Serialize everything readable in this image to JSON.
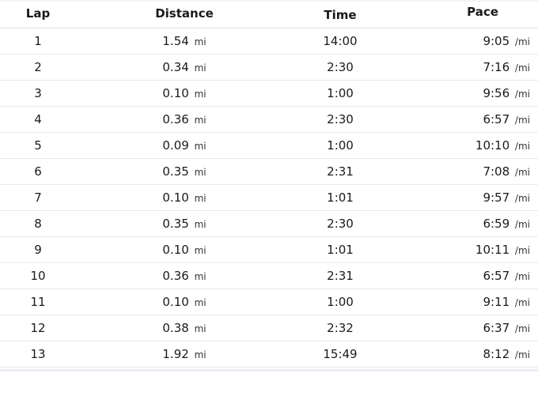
{
  "headers": {
    "lap": "Lap",
    "distance": "Distance",
    "time": "Time",
    "pace": "Pace"
  },
  "rows": [
    {
      "lap": "1",
      "distance": "1.54",
      "distance_unit": "mi",
      "time": "14:00",
      "pace": "9:05",
      "pace_unit": "/mi"
    },
    {
      "lap": "2",
      "distance": "0.34",
      "distance_unit": "mi",
      "time": "2:30",
      "pace": "7:16",
      "pace_unit": "/mi"
    },
    {
      "lap": "3",
      "distance": "0.10",
      "distance_unit": "mi",
      "time": "1:00",
      "pace": "9:56",
      "pace_unit": "/mi"
    },
    {
      "lap": "4",
      "distance": "0.36",
      "distance_unit": "mi",
      "time": "2:30",
      "pace": "6:57",
      "pace_unit": "/mi"
    },
    {
      "lap": "5",
      "distance": "0.09",
      "distance_unit": "mi",
      "time": "1:00",
      "pace": "10:10",
      "pace_unit": "/mi"
    },
    {
      "lap": "6",
      "distance": "0.35",
      "distance_unit": "mi",
      "time": "2:31",
      "pace": "7:08",
      "pace_unit": "/mi"
    },
    {
      "lap": "7",
      "distance": "0.10",
      "distance_unit": "mi",
      "time": "1:01",
      "pace": "9:57",
      "pace_unit": "/mi"
    },
    {
      "lap": "8",
      "distance": "0.35",
      "distance_unit": "mi",
      "time": "2:30",
      "pace": "6:59",
      "pace_unit": "/mi"
    },
    {
      "lap": "9",
      "distance": "0.10",
      "distance_unit": "mi",
      "time": "1:01",
      "pace": "10:11",
      "pace_unit": "/mi"
    },
    {
      "lap": "10",
      "distance": "0.36",
      "distance_unit": "mi",
      "time": "2:31",
      "pace": "6:57",
      "pace_unit": "/mi"
    },
    {
      "lap": "11",
      "distance": "0.10",
      "distance_unit": "mi",
      "time": "1:00",
      "pace": "9:11",
      "pace_unit": "/mi"
    },
    {
      "lap": "12",
      "distance": "0.38",
      "distance_unit": "mi",
      "time": "2:32",
      "pace": "6:37",
      "pace_unit": "/mi"
    },
    {
      "lap": "13",
      "distance": "1.92",
      "distance_unit": "mi",
      "time": "15:49",
      "pace": "8:12",
      "pace_unit": "/mi"
    }
  ]
}
